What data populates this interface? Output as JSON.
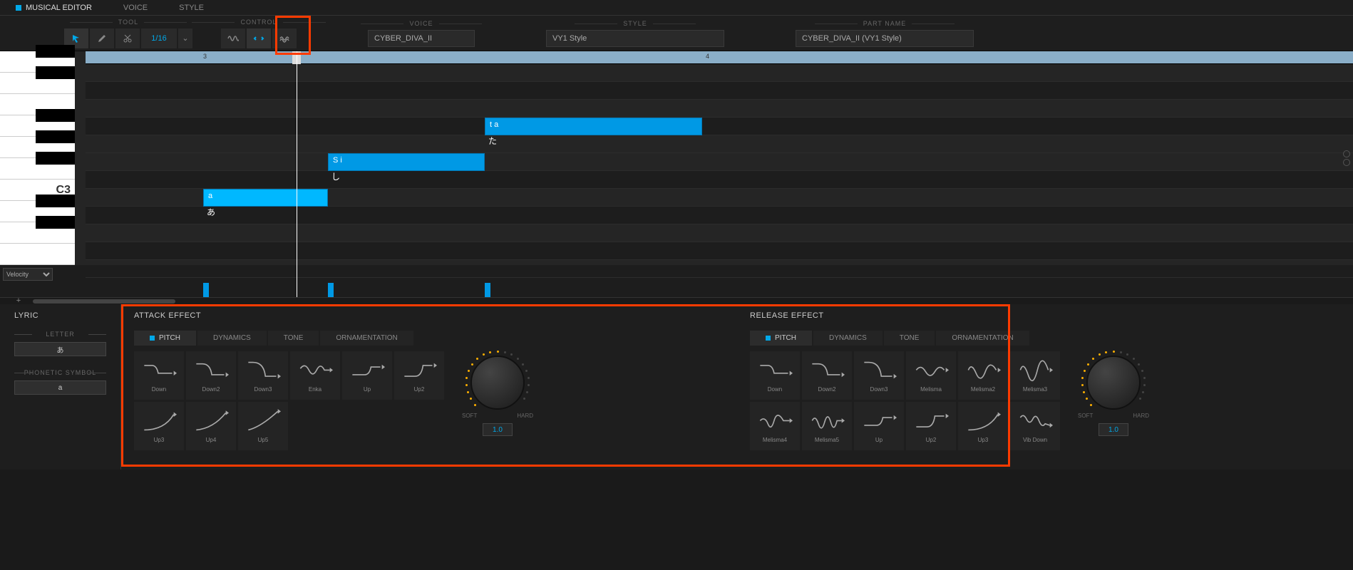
{
  "tabs": {
    "editor": "MUSICAL EDITOR",
    "voice": "VOICE",
    "style": "STYLE"
  },
  "toolbar": {
    "tool_label": "TOOL",
    "control_label": "CONTROL",
    "voice_label": "VOICE",
    "style_label": "STYLE",
    "partname_label": "PART NAME",
    "quantize": "1/16",
    "voice_value": "CYBER_DIVA_II",
    "style_value": "VY1 Style",
    "partname_value": "CYBER_DIVA_II (VY1 Style)"
  },
  "piano": {
    "c3_label": "C3"
  },
  "ruler": {
    "m3": "3",
    "m4": "4"
  },
  "notes": [
    {
      "phoneme": "a",
      "lyric": "あ"
    },
    {
      "phoneme": "S i",
      "lyric": "し"
    },
    {
      "phoneme": "t a",
      "lyric": "た"
    }
  ],
  "velocity": {
    "label": "Velocity"
  },
  "lyric": {
    "title": "LYRIC",
    "letter_label": "LETTER",
    "letter_value": "あ",
    "phonetic_label": "PHONETIC SYMBOL",
    "phonetic_value": "a"
  },
  "attack": {
    "title": "ATTACK EFFECT",
    "tabs": {
      "pitch": "PITCH",
      "dynamics": "DYNAMICS",
      "tone": "TONE",
      "orn": "ORNAMENTATION"
    },
    "presets": [
      "Down",
      "Down2",
      "Down3",
      "Enka",
      "Up",
      "Up2",
      "Up3",
      "Up4",
      "Up5"
    ],
    "knob": {
      "soft": "SOFT",
      "hard": "HARD",
      "value": "1.0"
    }
  },
  "release": {
    "title": "RELEASE EFFECT",
    "tabs": {
      "pitch": "PITCH",
      "dynamics": "DYNAMICS",
      "tone": "TONE",
      "orn": "ORNAMENTATION"
    },
    "presets": [
      "Down",
      "Down2",
      "Down3",
      "Melisma",
      "Melisma2",
      "Melisma3",
      "Melisma4",
      "Melisma5",
      "Up",
      "Up2",
      "Up3",
      "Vib Down"
    ],
    "knob": {
      "soft": "SOFT",
      "hard": "HARD",
      "value": "1.0"
    }
  }
}
